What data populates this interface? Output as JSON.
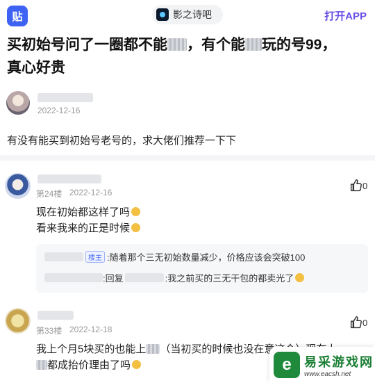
{
  "app": {
    "logo": "贴",
    "open_app": "打开APP",
    "forum_name": "影之诗吧"
  },
  "post": {
    "title_parts": [
      "买初始号问了一圈都不能",
      "，有个能",
      "玩的号99，",
      "真心好贵"
    ],
    "date": "2022-12-16",
    "content": "有没有能买到初始号老号的，求大佬们推荐一下下"
  },
  "replies": [
    {
      "floor": "第24楼",
      "date": "2022-12-16",
      "likes": "0",
      "lines": [
        "现在初始都这样了吗",
        "看来我来的正是时候"
      ],
      "subreplies": [
        {
          "badge": "楼主",
          "text": ":随着那个三无初始数量减少，价格应该会突破100"
        },
        {
          "middle": ":回复",
          "text": ":我之前买的三无干包的都卖光了"
        }
      ]
    },
    {
      "floor": "第33楼",
      "date": "2022-12-18",
      "likes": "0",
      "lines": [
        "我上个月5块买的也能上",
        "（当初买的时候也没在意这个）现在上",
        "都成抬价理由了吗"
      ]
    }
  ],
  "watermark": {
    "logo": "e",
    "title": "易采游戏网",
    "url": "www.eacsh.net"
  }
}
